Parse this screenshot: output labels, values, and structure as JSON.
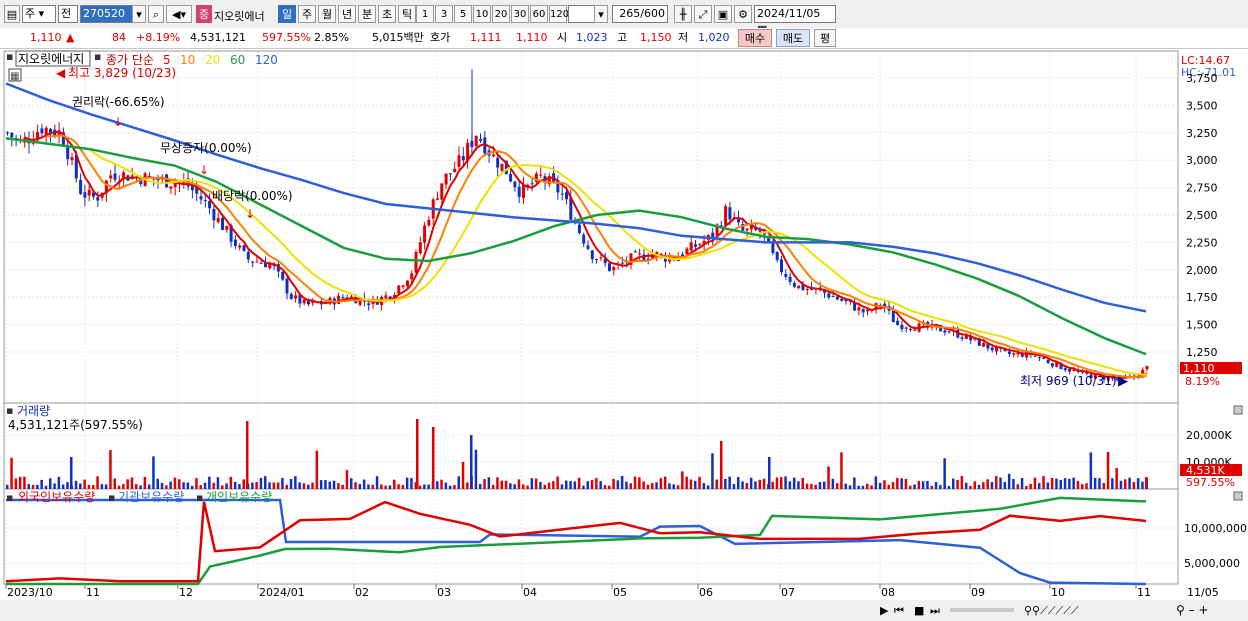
{
  "toolbar": {
    "market": "주",
    "prev_label": "전",
    "code": "270520",
    "stock_name": "지오릿에너",
    "stock_badge": "증",
    "periods": [
      {
        "label": "일",
        "selected": true
      },
      {
        "label": "주",
        "selected": false
      },
      {
        "label": "월",
        "selected": false
      },
      {
        "label": "년",
        "selected": false
      },
      {
        "label": "분",
        "selected": false
      },
      {
        "label": "초",
        "selected": false
      },
      {
        "label": "틱",
        "selected": false
      }
    ],
    "intervals": [
      "1",
      "3",
      "5",
      "10",
      "20",
      "30",
      "60",
      "120"
    ],
    "count": "265",
    "count_max": "/600",
    "date": "2024/11/05"
  },
  "quote": {
    "price": "1,110",
    "change_arrow": "▲",
    "change": "84",
    "change_pct": "+8.19%",
    "volume": "4,531,121",
    "volume_pct": "597.55%",
    "turnover": "2.85%",
    "amount": "5,015백만",
    "ask_label": "호가",
    "ask": "1,111",
    "bid": "1,110",
    "open_label": "시",
    "open": "1,023",
    "high_label": "고",
    "high": "1,150",
    "low_label": "저",
    "low": "1,020",
    "buy_label": "매수",
    "sell_label": "매도",
    "eval_label": "평"
  },
  "price_panel": {
    "legend_name": "지오릿에너지",
    "legend_ma_label": "종가 단순",
    "ma_periods": [
      {
        "p": "5",
        "color": "#e00000"
      },
      {
        "p": "10",
        "color": "#ff8000"
      },
      {
        "p": "20",
        "color": "#f0e000"
      },
      {
        "p": "60",
        "color": "#1a9e3c"
      },
      {
        "p": "120",
        "color": "#2d5fd8"
      }
    ],
    "lc_label": "LC:14.67",
    "hc_label": "HC:-71.01",
    "y_ticks": [
      "3,750",
      "3,500",
      "3,250",
      "3,000",
      "2,750",
      "2,500",
      "2,250",
      "2,000",
      "1,750",
      "1,500",
      "1,250"
    ],
    "high_annotation": "최고 3,829 (10/23)",
    "low_annotation": "최저 969 (10/31)",
    "events": [
      "권리락(-66.65%)",
      "무상증자(0.00%)",
      "배당락(0.00%)"
    ],
    "price_tag": "1,110",
    "pct_tag": "8.19%"
  },
  "volume_panel": {
    "title": "거래량",
    "value": "4,531,121주(597.55%)",
    "y_ticks": [
      "20,000K",
      "10,000K"
    ],
    "tag": "4,531K",
    "pct_tag": "597.55%"
  },
  "holding_panel": {
    "legends": [
      {
        "label": "외국인보유수량",
        "color": "#e00000"
      },
      {
        "label": "기관보유수량",
        "color": "#2d5fd8"
      },
      {
        "label": "개인보유수량",
        "color": "#1a9e3c"
      }
    ],
    "y_ticks": [
      "10,000,000",
      "5,000,000"
    ]
  },
  "x_axis": [
    "2023/10",
    "11",
    "12",
    "2024/01",
    "02",
    "03",
    "04",
    "05",
    "06",
    "07",
    "08",
    "09",
    "10",
    "11"
  ],
  "x_axis_right": "11/05",
  "colors": {
    "up": "#e00000",
    "down": "#1030c0",
    "ma5": "#e00000",
    "ma10": "#ff8000",
    "ma20": "#f0e000",
    "ma60": "#1a9e3c",
    "ma120": "#2d5fd8"
  },
  "chart_data": {
    "type": "line",
    "title": "지오릿에너지",
    "y_range": [
      950,
      3829
    ],
    "series": [
      {
        "name": "120",
        "values": [
          3700,
          3550,
          3420,
          3300,
          3180,
          3050,
          2930,
          2820,
          2700,
          2600,
          2560,
          2520,
          2480,
          2450,
          2420,
          2380,
          2310,
          2280,
          2250,
          2250,
          2250,
          2210,
          2150,
          2060,
          1950,
          1820,
          1700,
          1620
        ]
      },
      {
        "name": "60",
        "values": [
          3200,
          3150,
          3100,
          3020,
          2950,
          2800,
          2600,
          2400,
          2200,
          2100,
          2080,
          2150,
          2260,
          2400,
          2500,
          2540,
          2480,
          2380,
          2300,
          2280,
          2230,
          2160,
          2050,
          1920,
          1760,
          1560,
          1380,
          1230
        ]
      },
      {
        "name": "20",
        "values": [
          3350,
          3100,
          2950,
          2900,
          2750,
          2400,
          2100,
          1800,
          1700,
          1750,
          2000,
          2900,
          2950,
          2600,
          2200,
          2050,
          2150,
          2350,
          2250,
          2050,
          1850,
          1600,
          1430,
          1300,
          1180,
          1100
        ]
      }
    ]
  }
}
